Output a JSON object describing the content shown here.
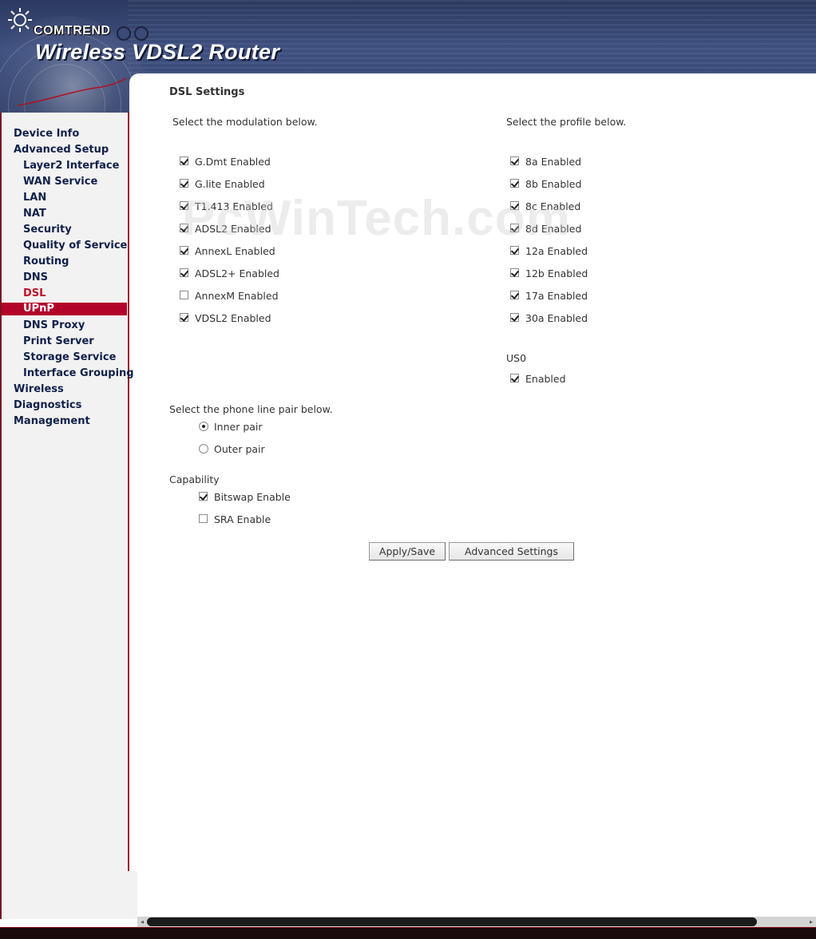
{
  "header": {
    "brand": "COMTREND",
    "product": "Wireless VDSL2 Router"
  },
  "colors": {
    "nav_text": "#10204a",
    "nav_current": "#c0102a",
    "nav_highlight_bg": "#b3042a",
    "banner": "#3f5080"
  },
  "sidebar": {
    "items": [
      {
        "label": "Device Info"
      },
      {
        "label": "Advanced Setup"
      },
      {
        "label": "Layer2 Interface"
      },
      {
        "label": "WAN Service"
      },
      {
        "label": "LAN"
      },
      {
        "label": "NAT"
      },
      {
        "label": "Security"
      },
      {
        "label": "Quality of Service"
      },
      {
        "label": "Routing"
      },
      {
        "label": "DNS"
      },
      {
        "label": "DSL"
      },
      {
        "label": "UPnP"
      },
      {
        "label": "DNS Proxy"
      },
      {
        "label": "Print Server"
      },
      {
        "label": "Storage Service"
      },
      {
        "label": "Interface Grouping"
      },
      {
        "label": "Wireless"
      },
      {
        "label": "Diagnostics"
      },
      {
        "label": "Management"
      }
    ]
  },
  "main": {
    "title": "DSL Settings",
    "watermark": "PcWinTech.com",
    "modulation": {
      "prompt": "Select the modulation below.",
      "options": [
        {
          "label": "G.Dmt Enabled",
          "checked": true
        },
        {
          "label": "G.lite Enabled",
          "checked": true
        },
        {
          "label": "T1.413 Enabled",
          "checked": true
        },
        {
          "label": "ADSL2 Enabled",
          "checked": true
        },
        {
          "label": "AnnexL Enabled",
          "checked": true
        },
        {
          "label": "ADSL2+ Enabled",
          "checked": true
        },
        {
          "label": "AnnexM Enabled",
          "checked": false
        },
        {
          "label": "VDSL2 Enabled",
          "checked": true
        }
      ]
    },
    "profile": {
      "prompt": "Select the profile below.",
      "options": [
        {
          "label": "8a Enabled",
          "checked": true
        },
        {
          "label": "8b Enabled",
          "checked": true
        },
        {
          "label": "8c Enabled",
          "checked": true
        },
        {
          "label": "8d Enabled",
          "checked": true
        },
        {
          "label": "12a Enabled",
          "checked": true
        },
        {
          "label": "12b Enabled",
          "checked": true
        },
        {
          "label": "17a Enabled",
          "checked": true
        },
        {
          "label": "30a Enabled",
          "checked": true
        }
      ]
    },
    "us0": {
      "heading": "US0",
      "label": "Enabled",
      "checked": true
    },
    "phone_line": {
      "prompt": "Select the phone line pair below.",
      "options": [
        {
          "label": "Inner pair",
          "selected": true
        },
        {
          "label": "Outer pair",
          "selected": false
        }
      ]
    },
    "capability": {
      "heading": "Capability",
      "options": [
        {
          "label": "Bitswap Enable",
          "checked": true
        },
        {
          "label": "SRA Enable",
          "checked": false
        }
      ]
    },
    "buttons": {
      "apply": "Apply/Save",
      "advanced": "Advanced Settings"
    }
  }
}
